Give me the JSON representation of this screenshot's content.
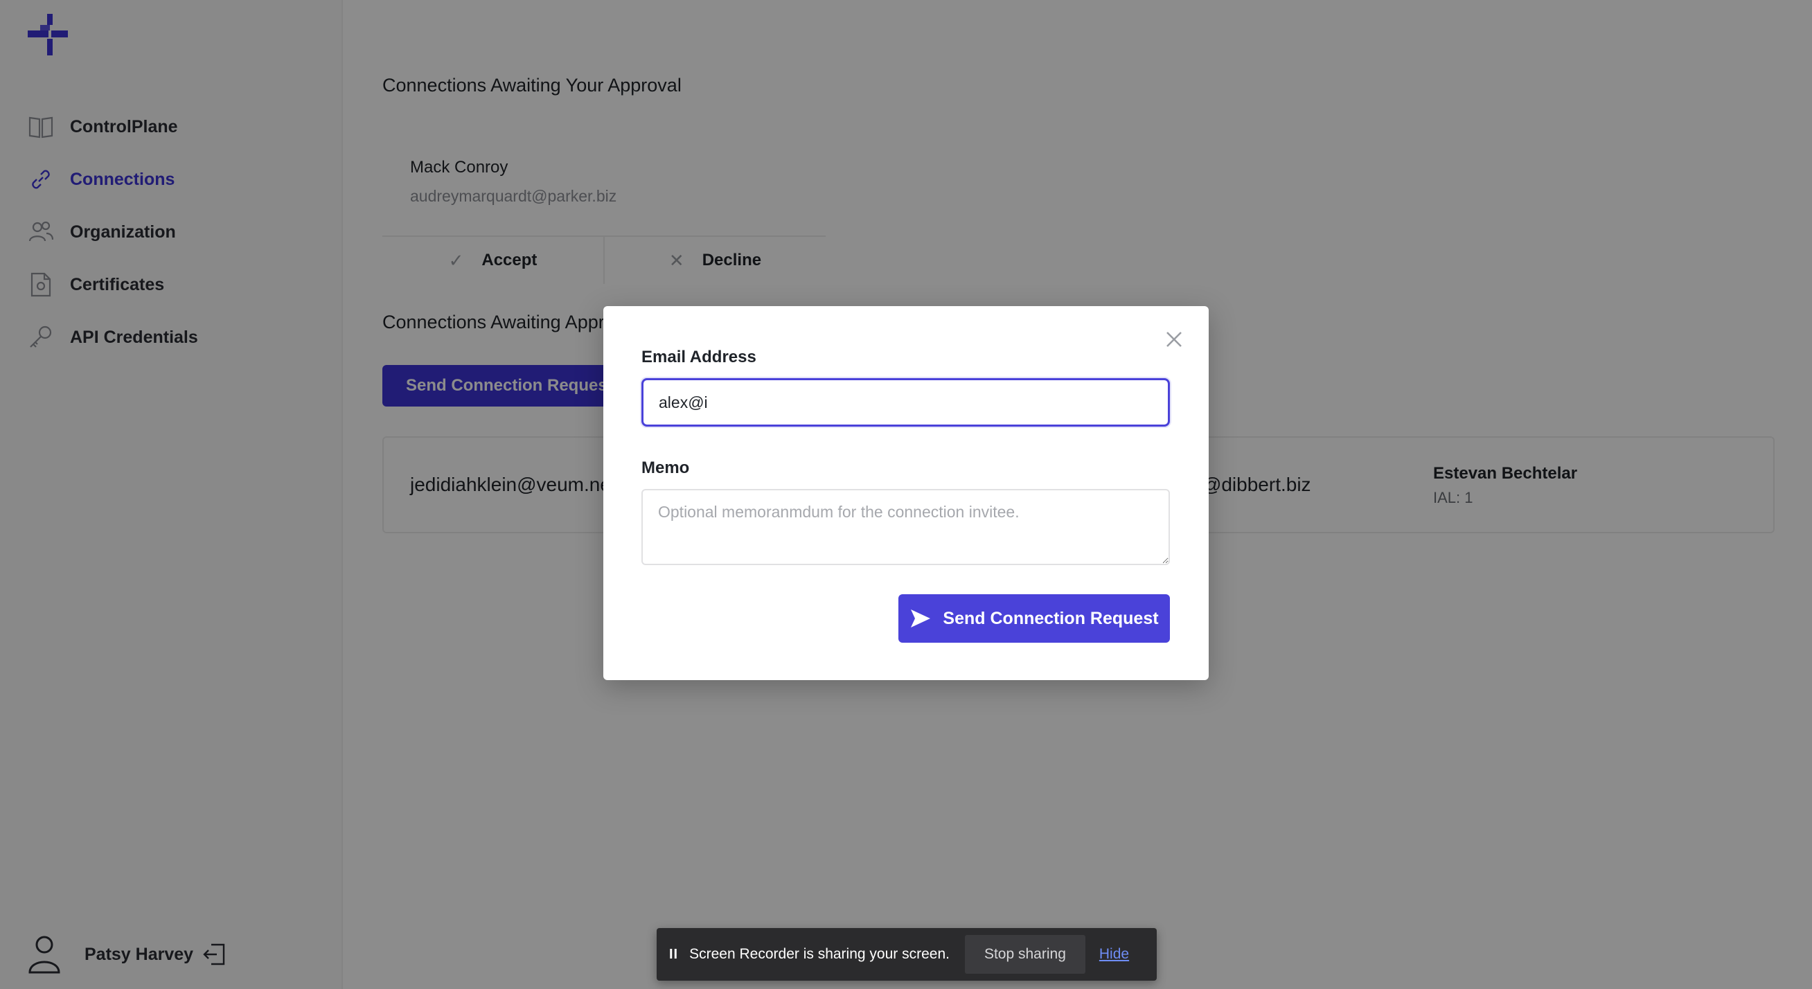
{
  "sidebar": {
    "items": [
      {
        "label": "ControlPlane",
        "icon": "book-icon",
        "active": false
      },
      {
        "label": "Connections",
        "icon": "link-icon",
        "active": true
      },
      {
        "label": "Organization",
        "icon": "users-icon",
        "active": false
      },
      {
        "label": "Certificates",
        "icon": "certificate-icon",
        "active": false
      },
      {
        "label": "API Credentials",
        "icon": "key-icon",
        "active": false
      }
    ],
    "user": {
      "name": "Patsy Harvey"
    }
  },
  "main": {
    "approval_title": "Connections Awaiting Your Approval",
    "approval": {
      "name": "Mack Conroy",
      "email": "audreymarquardt@parker.biz",
      "accept_label": "Accept",
      "decline_label": "Decline"
    },
    "pending_title": "Connections Awaiting Approval",
    "send_button_label": "Send Connection Request",
    "connection_row": {
      "email_left": "jedidiahklein@veum.net",
      "email_right": "kenzie@dibbert.biz",
      "name": "Estevan Bechtelar",
      "ial": "IAL: 1"
    }
  },
  "modal": {
    "email_label": "Email Address",
    "email_value": "alex@i",
    "memo_label": "Memo",
    "memo_placeholder": "Optional memoranmdum for the connection invitee.",
    "submit_label": "Send Connection Request"
  },
  "recorder": {
    "pause": "II",
    "message": "Screen Recorder is sharing your screen.",
    "stop_label": "Stop sharing",
    "hide_label": "Hide"
  },
  "colors": {
    "accent": "#3d34d6",
    "overlay": "#000000"
  }
}
